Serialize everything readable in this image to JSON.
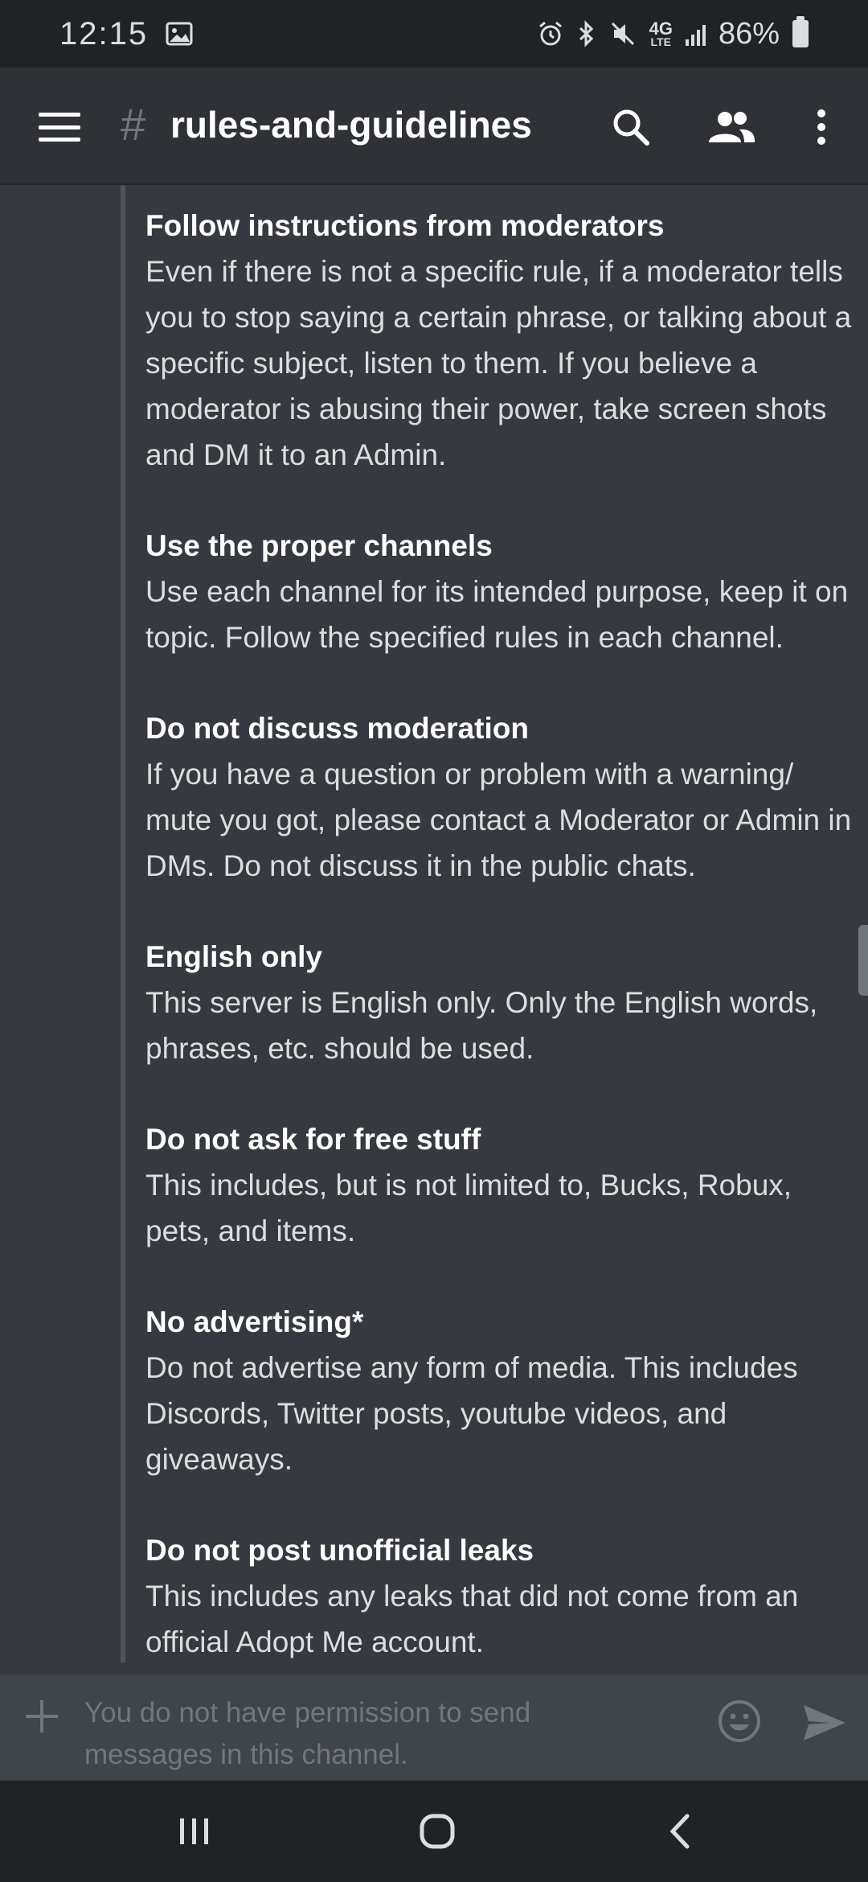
{
  "status_bar": {
    "time": "12:15",
    "network": "4G",
    "network_sub": "LTE",
    "battery": "86%"
  },
  "header": {
    "hash_symbol": "#",
    "channel_name": "rules-and-guidelines"
  },
  "rules": [
    {
      "title": "Follow instructions from moderators",
      "body": "Even if there is not a specific rule, if a moderator tells you to stop saying a certain phrase, or talking about a specific subject, listen to them. If you believe a moderator is abusing their power, take screen shots and DM it to an Admin."
    },
    {
      "title": "Use the proper channels",
      "body": "Use each channel for its intended purpose, keep it on topic. Follow the specified rules in each channel."
    },
    {
      "title": "Do not discuss moderation",
      "body": "If you have a question or problem with a warning/ mute you got, please contact a Moderator or Admin in DMs. Do not discuss it in the public chats."
    },
    {
      "title": "English only",
      "body": "This server is English only. Only the English words, phrases, etc. should be used."
    },
    {
      "title": "Do not ask for free stuff",
      "body": "This includes, but is not limited to, Bucks, Robux, pets, and items."
    },
    {
      "title": "No advertising*",
      "body": "Do not advertise any form of media. This includes Discords, Twitter posts, youtube videos, and giveaways."
    },
    {
      "title": "Do not post unofficial leaks",
      "body": "This includes any leaks that did not come from an official Adopt Me account."
    }
  ],
  "input": {
    "placeholder": "You do not have permission to send messages in this channel."
  },
  "icons": {
    "menu": "hamburger-menu-icon",
    "search": "search-icon",
    "members": "members-icon",
    "more": "more-vertical-icon",
    "add": "plus-icon",
    "emoji": "emoji-icon",
    "send": "send-icon",
    "recents": "recents-icon",
    "home": "home-icon",
    "back": "back-icon"
  },
  "colors": {
    "background": "#36393f",
    "header": "#2f3136",
    "input": "#40444b",
    "text": "#dcddde",
    "muted": "#72767d"
  }
}
